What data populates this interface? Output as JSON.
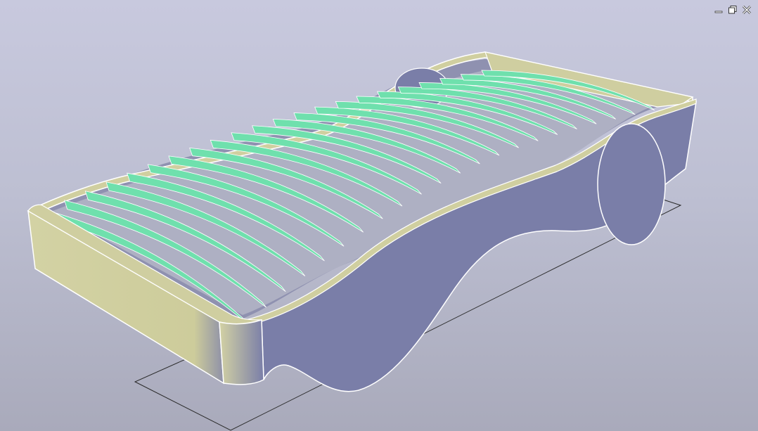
{
  "window": {
    "controls": [
      {
        "name": "minimize",
        "icon": "minimize-icon"
      },
      {
        "name": "restore",
        "icon": "restore-icon"
      },
      {
        "name": "close",
        "icon": "close-icon"
      }
    ]
  },
  "scene": {
    "object": "bed-frame-with-slats",
    "background_top": "#c8c9de",
    "background_bottom": "#a9aabb",
    "frame_side_color": "#7a7ea8",
    "frame_end_color": "#d0cfa0",
    "slat_color": "#6fe0ad",
    "edge_color": "#ffffff",
    "ground_grid_color": "#2a2a2a",
    "slat_count": 22
  }
}
